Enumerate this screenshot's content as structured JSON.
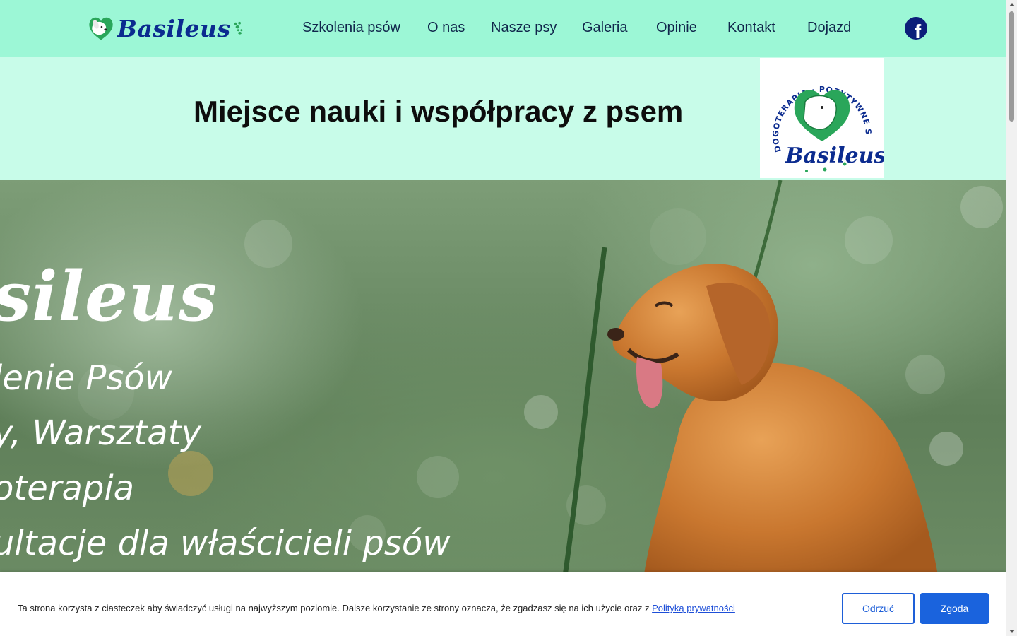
{
  "header": {
    "logo_text": "Basileus",
    "nav": [
      {
        "label": "Szkolenia psów"
      },
      {
        "label": "O nas"
      },
      {
        "label": "Nasze psy"
      },
      {
        "label": "Galeria"
      },
      {
        "label": "Opinie"
      },
      {
        "label": "Kontakt"
      },
      {
        "label": "Dojazd"
      }
    ],
    "social_icon": "facebook-icon"
  },
  "band": {
    "tagline": "Miejsce nauki i współpracy z psem",
    "badge": {
      "ring_text": "DOGOTERAPIA · POZYTYWNE SZKOLENIE PSÓW",
      "name": "Basileus"
    }
  },
  "hero": {
    "title": "sileus",
    "lines": [
      "lenie Psów",
      "y, Warsztaty",
      "oterapia",
      "ultacje dla właścicieli psów"
    ]
  },
  "cookie": {
    "text": "Ta strona korzysta z ciasteczek aby świadczyć usługi na najwyższym poziomie. Dalsze korzystanie ze strony oznacza, że zgadzasz się na ich użycie oraz z",
    "link": "Polityką prywatności",
    "decline": "Odrzuć",
    "accept": "Zgoda"
  },
  "colors": {
    "header_bg": "#9cf7d6",
    "band_bg": "#c8fce9",
    "brand_navy": "#0b2b8f",
    "brand_green": "#2aa65a",
    "button_blue": "#1a63dd"
  }
}
